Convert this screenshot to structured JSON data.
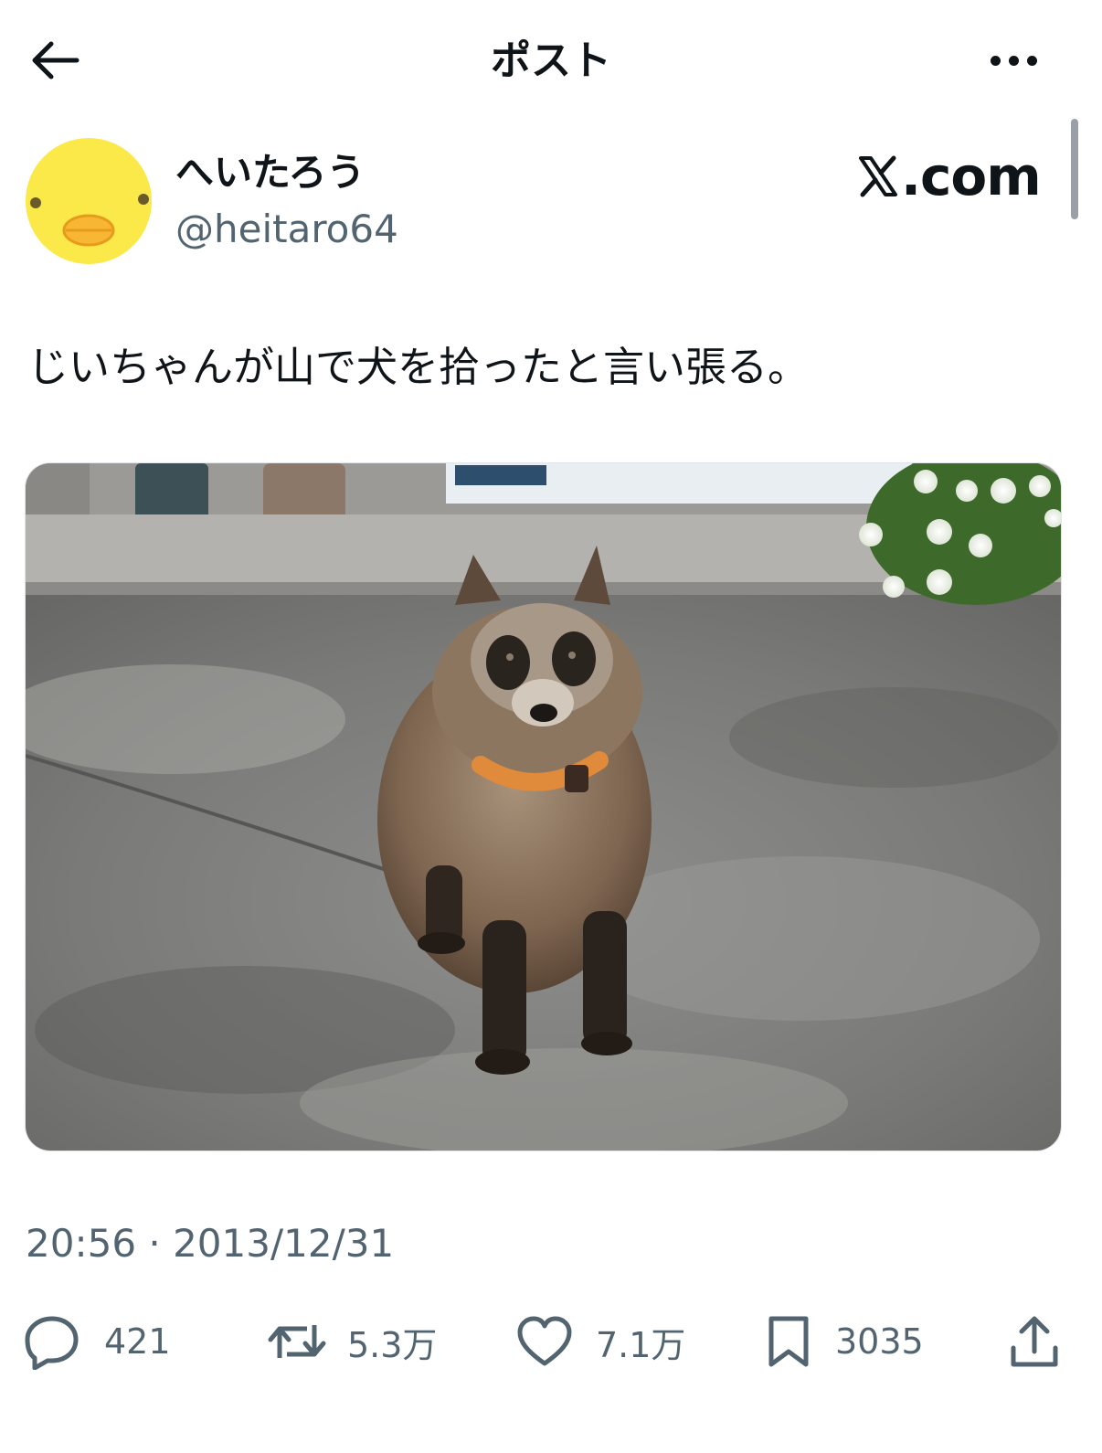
{
  "header": {
    "title": "ポスト"
  },
  "author": {
    "display_name": "へいたろう",
    "handle": "@heitaro64",
    "avatar_color": "#fbe94a"
  },
  "site": {
    "label": ".com"
  },
  "post": {
    "text": "じいちゃんが山で犬を拾ったと言い張る。",
    "photo_subject": "raccoon-dog-with-orange-collar"
  },
  "meta": {
    "timestamp": "20:56 · 2013/12/31"
  },
  "actions": {
    "replies": "421",
    "reposts": "5.3万",
    "likes": "7.1万",
    "bookmarks": "3035"
  },
  "colors": {
    "text_primary": "#0f1419",
    "text_secondary": "#536471"
  },
  "icons": [
    "back-arrow-icon",
    "more-icon",
    "x-logo-icon",
    "reply-icon",
    "repost-icon",
    "like-icon",
    "bookmark-icon",
    "share-icon"
  ]
}
